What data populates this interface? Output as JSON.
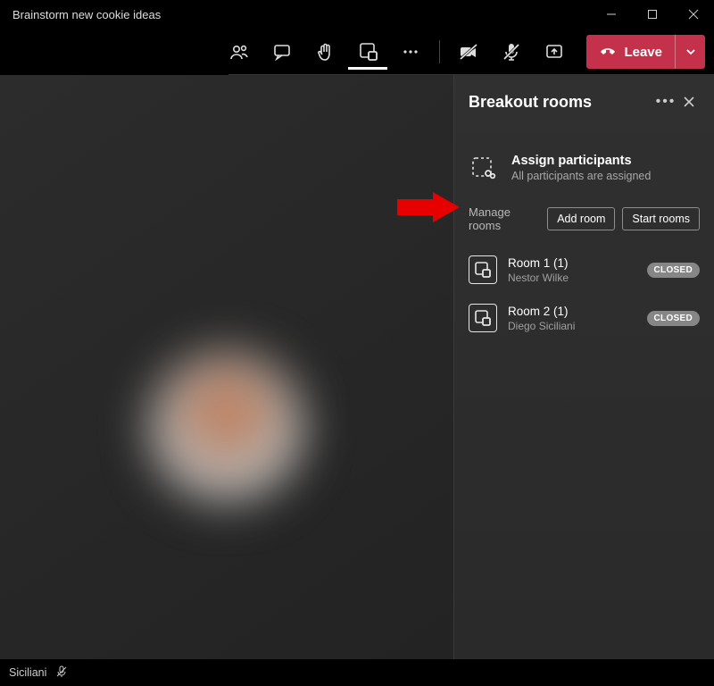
{
  "window": {
    "title": "Brainstorm new cookie ideas"
  },
  "leave": {
    "label": "Leave"
  },
  "panel": {
    "title": "Breakout rooms",
    "assign_title": "Assign participants",
    "assign_subtitle": "All participants are assigned",
    "manage_label": "Manage rooms",
    "add_room_label": "Add room",
    "start_rooms_label": "Start rooms"
  },
  "rooms": [
    {
      "name": "Room 1 (1)",
      "participant": "Nestor Wilke",
      "status": "CLOSED"
    },
    {
      "name": "Room 2 (1)",
      "participant": "Diego Siciliani",
      "status": "CLOSED"
    }
  ],
  "footer": {
    "speaker": "Siciliani"
  }
}
